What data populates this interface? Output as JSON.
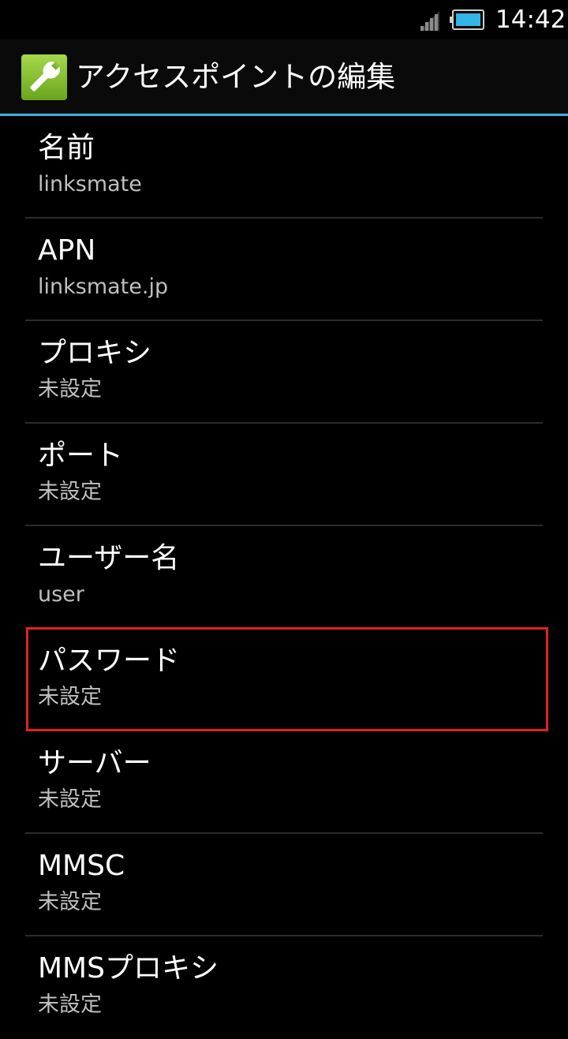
{
  "status_bar": {
    "time": "14:42",
    "signal_icon": "signal-strength-icon",
    "battery_icon": "battery-icon"
  },
  "action_bar": {
    "icon": "wrench-icon",
    "title": "アクセスポイントの編集",
    "accent_color": "#33b5e5"
  },
  "preferences": [
    {
      "title": "名前",
      "summary": "linksmate"
    },
    {
      "title": "APN",
      "summary": "linksmate.jp"
    },
    {
      "title": "プロキシ",
      "summary": "未設定"
    },
    {
      "title": "ポート",
      "summary": "未設定"
    },
    {
      "title": "ユーザー名",
      "summary": "user"
    },
    {
      "title": "パスワード",
      "summary": "未設定",
      "highlighted": true
    },
    {
      "title": "サーバー",
      "summary": "未設定"
    },
    {
      "title": "MMSC",
      "summary": "未設定"
    },
    {
      "title": "MMSプロキシ",
      "summary": "未設定"
    }
  ],
  "highlight_color": "#e02222"
}
